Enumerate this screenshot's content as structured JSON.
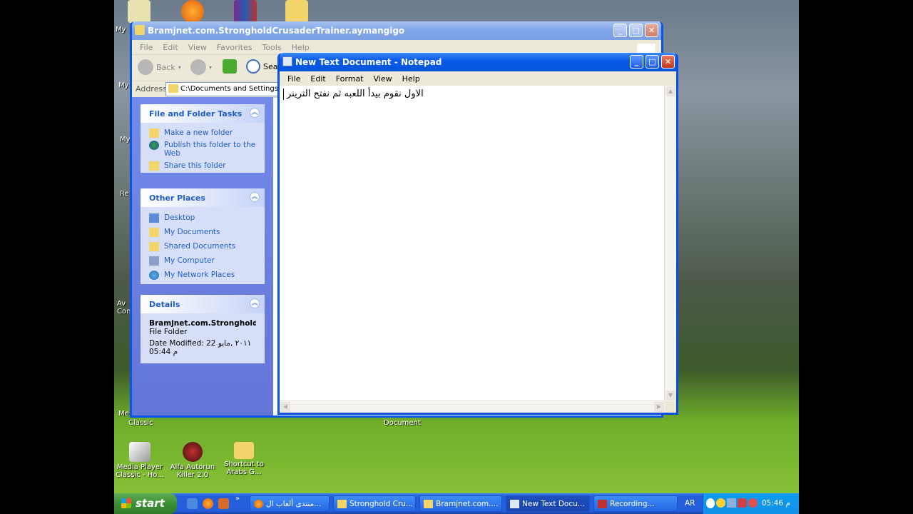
{
  "desktop": {
    "top_icons": [
      "",
      "",
      "",
      ""
    ],
    "edge_labels": [
      "My",
      "My",
      "My",
      "Re",
      "Av Con",
      "Me"
    ],
    "bottom_icons": [
      {
        "label": "Media Player Classic - Ho...",
        "icon": "media-player-icon"
      },
      {
        "label": "Alfa Autorun Killer 2.0",
        "icon": "spider-icon"
      },
      {
        "label": "Shortcut to Arabs G...",
        "icon": "folder-shortcut-icon"
      }
    ],
    "partial_labels": [
      "Classic",
      "Document"
    ]
  },
  "explorer": {
    "title": "Bramjnet.com.StrongholdCrusaderTrainer.aymangigo",
    "menu": [
      "File",
      "Edit",
      "View",
      "Favorites",
      "Tools",
      "Help"
    ],
    "toolbar": {
      "back": "Back",
      "search": "Sear"
    },
    "address_label": "Address",
    "address_value": "C:\\Documents and Settings\\os",
    "panels": {
      "file_tasks": {
        "title": "File and Folder Tasks",
        "items": [
          "Make a new folder",
          "Publish this folder to the Web",
          "Share this folder"
        ]
      },
      "other_places": {
        "title": "Other Places",
        "items": [
          "Desktop",
          "My Documents",
          "Shared Documents",
          "My Computer",
          "My Network Places"
        ]
      },
      "details": {
        "title": "Details",
        "name": "Bramjnet.com.StrongholdCr",
        "type": "File Folder",
        "modified_line1": "Date Modified: 22 ٢٠١١ ,مايو",
        "modified_line2": "05:44 م"
      }
    }
  },
  "notepad": {
    "title": "New Text Document - Notepad",
    "menu": [
      "File",
      "Edit",
      "Format",
      "View",
      "Help"
    ],
    "content": "الاول نقوم بيدأ اللعبه ثم نفتح الترينر"
  },
  "taskbar": {
    "start_label": "start",
    "tasks": [
      {
        "label": "منتدى ألعاب ال...",
        "icon": "firefox-icon"
      },
      {
        "label": "Stronghold Cru...",
        "icon": "folder-icon"
      },
      {
        "label": "Bramjnet.com....",
        "icon": "folder-icon"
      },
      {
        "label": "New Text Docu...",
        "icon": "notepad-icon"
      },
      {
        "label": "Recording...",
        "icon": "recording-icon"
      }
    ],
    "language": "AR",
    "clock": "05:46 م",
    "chevron": "»"
  }
}
